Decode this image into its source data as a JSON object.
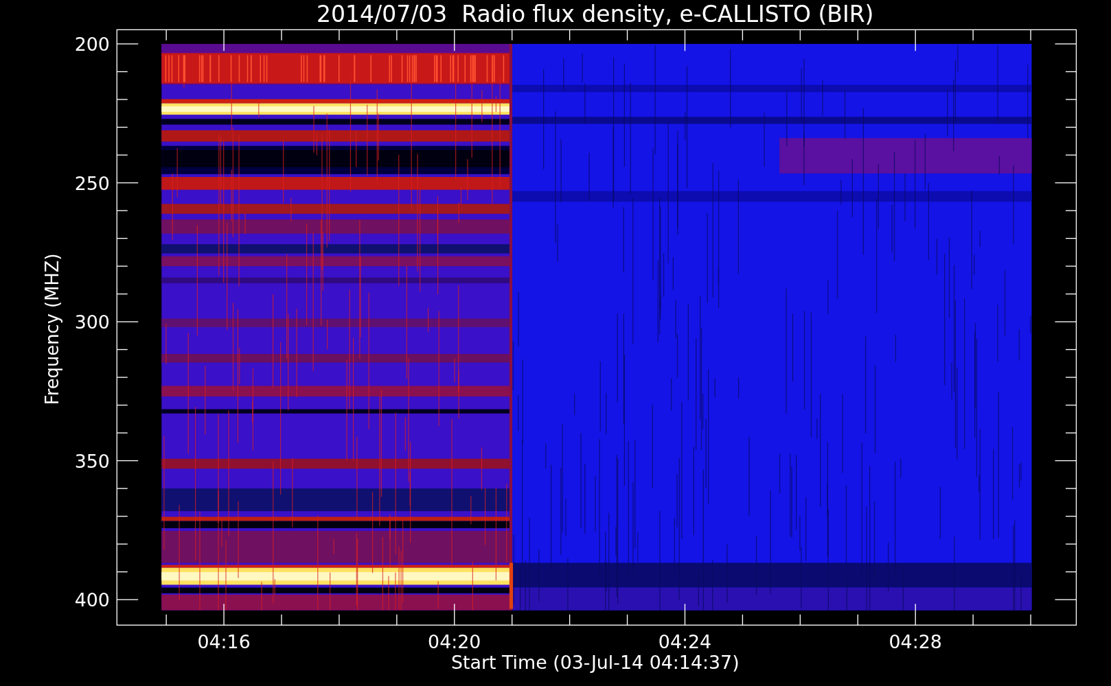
{
  "title": "2014/07/03  Radio flux density, e-CALLISTO (BIR)",
  "y_axis": {
    "label": "Frequency (MHZ)",
    "ticks": [
      "200",
      "250",
      "300",
      "350",
      "400"
    ]
  },
  "x_axis": {
    "label": "Start Time (03-Jul-14 04:14:37)",
    "ticks": [
      "04:16",
      "04:20",
      "04:24",
      "04:28"
    ]
  }
}
